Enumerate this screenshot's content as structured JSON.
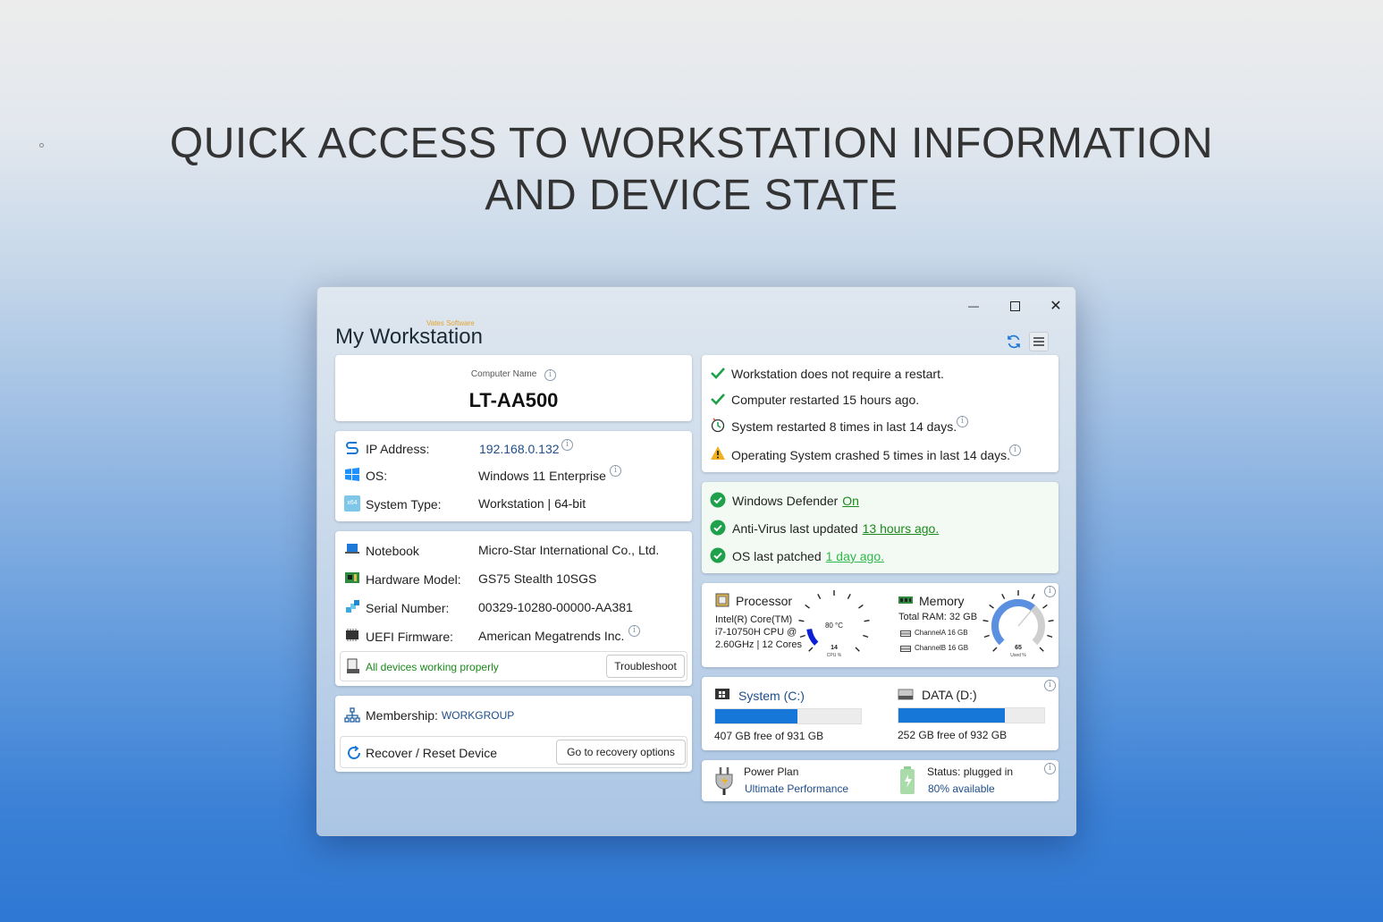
{
  "headline": {
    "line1": "QUICK ACCESS TO WORKSTATION INFORMATION",
    "line2": "AND DEVICE STATE"
  },
  "window": {
    "title": "My Workstation",
    "subtitle": "Vates Software",
    "controls": {
      "minimize": "—",
      "maximize": "☐",
      "close": "✕"
    }
  },
  "computer": {
    "label": "Computer Name",
    "name": "LT-AA500"
  },
  "network": {
    "ip_label": "IP Address:",
    "ip_value": "192.168.0.132",
    "os_label": "OS:",
    "os_value": "Windows 11 Enterprise",
    "type_label": "System Type:",
    "type_value": "Workstation | 64-bit",
    "type_icon_text": "x64"
  },
  "hardware": {
    "device_label": "Notebook",
    "device_value": "Micro-Star International Co., Ltd.",
    "model_label": "Hardware Model:",
    "model_value": "GS75 Stealth 10SGS",
    "serial_label": "Serial Number:",
    "serial_value": "00329-10280-00000-AA381",
    "uefi_label": "UEFI Firmware:",
    "uefi_value": "American Megatrends Inc.",
    "devices_status": "All devices working properly",
    "troubleshoot_label": "Troubleshoot"
  },
  "membership": {
    "label": "Membership:",
    "value": "WORKGROUP",
    "recover_label": "Recover / Reset Device",
    "recovery_button": "Go to recovery options"
  },
  "status": {
    "items": [
      "Workstation does not require a restart.",
      "Computer restarted 15 hours ago.",
      "System restarted 8 times in last 14 days.",
      "Operating System crashed 5 times in last 14 days."
    ]
  },
  "security": {
    "defender_label": "Windows Defender",
    "defender_value": "On",
    "av_label": "Anti-Virus last updated",
    "av_value": "13 hours ago.",
    "patch_label": "OS last patched",
    "patch_value": "1 day ago."
  },
  "processor": {
    "title": "Processor",
    "line1": "Intel(R) Core(TM)",
    "line2": "i7-10750H CPU @",
    "line3": "2.60GHz | 12 Cores",
    "temp": "80 °C",
    "usage": "14",
    "usage_label": "CPU %",
    "usage_fraction": 0.14
  },
  "memory": {
    "title": "Memory",
    "total": "Total RAM: 32 GB",
    "channel_a": "ChannelA 16 GB",
    "channel_b": "ChannelB 16 GB",
    "used": "65",
    "used_label": "Used %",
    "used_fraction": 0.65
  },
  "drives": [
    {
      "name": "System (C:)",
      "free_text": "407 GB free of 931 GB",
      "used_fraction": 0.563
    },
    {
      "name": "DATA (D:)",
      "free_text": "252 GB free of 932 GB",
      "used_fraction": 0.73
    }
  ],
  "power": {
    "plan_label": "Power Plan",
    "plan_value": "Ultimate Performance",
    "status_label": "Status: plugged in",
    "status_value": "80% available"
  },
  "colors": {
    "accent": "#1677d8",
    "ok_green": "#1fa04a",
    "warning": "#f2b01e",
    "link": "#1f4e8a"
  }
}
